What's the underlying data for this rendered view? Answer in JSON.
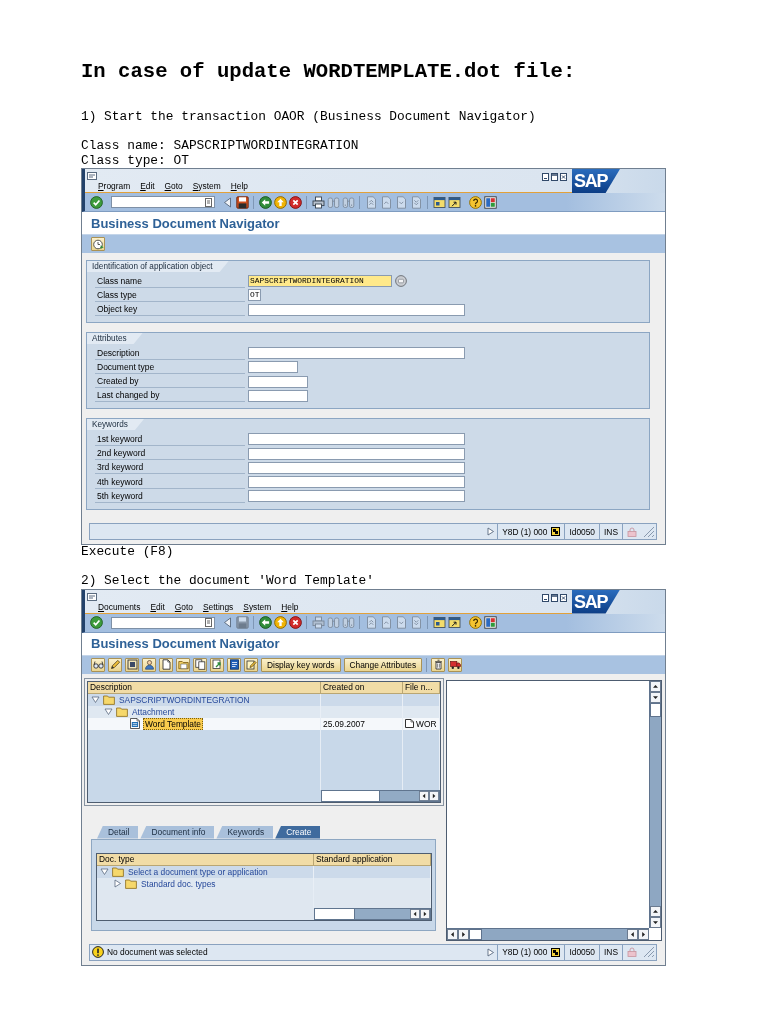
{
  "heading": "In case of update WORDTEMPLATE.dot file:",
  "content": [
    {
      "kind": "text",
      "lines": [
        "1) Start the transaction OAOR (Business Document Navigator)"
      ]
    },
    {
      "kind": "text",
      "lines": [
        "Class name: SAPSCRIPTWORDINTEGRATION",
        "Class type: OT"
      ]
    },
    {
      "kind": "screen",
      "logo": "SAP",
      "menu": [
        "Program",
        "Edit",
        "Goto",
        "System",
        "Help"
      ],
      "toolbar": [
        {
          "kind": "enter",
          "disabled": false
        },
        {
          "kind": "command"
        },
        {
          "kind": "collapse",
          "disabled": false
        },
        {
          "kind": "save",
          "disabled": false
        },
        {
          "kind": "separator"
        },
        {
          "kind": "back",
          "disabled": false
        },
        {
          "kind": "exit",
          "disabled": false
        },
        {
          "kind": "cancel",
          "disabled": false
        },
        {
          "kind": "separator"
        },
        {
          "kind": "print",
          "disabled": false
        },
        {
          "kind": "find",
          "disabled": true
        },
        {
          "kind": "findnext",
          "disabled": true
        },
        {
          "kind": "separator"
        },
        {
          "kind": "first",
          "disabled": true
        },
        {
          "kind": "previous",
          "disabled": true
        },
        {
          "kind": "next",
          "disabled": true
        },
        {
          "kind": "last",
          "disabled": true
        },
        {
          "kind": "separator"
        },
        {
          "kind": "session",
          "disabled": false
        },
        {
          "kind": "shortcut",
          "disabled": false
        },
        {
          "kind": "space"
        },
        {
          "kind": "help",
          "disabled": false
        },
        {
          "kind": "layout",
          "disabled": false
        }
      ],
      "title": "Business Document Navigator",
      "app_toolbar": [
        {
          "kind": "execute"
        }
      ],
      "body": {
        "kind": "form",
        "groups": [
          {
            "title": "Identification of application object",
            "fields": [
              {
                "label": "Class name",
                "value": "SAPSCRIPTWORDINTEGRATION",
                "kind": "large",
                "focused": true
              },
              {
                "label": "Class type",
                "value": "OT",
                "kind": "tiny",
                "focused": false
              },
              {
                "label": "Object key",
                "kind": "full",
                "focused": false
              }
            ]
          },
          {
            "title": "Attributes",
            "fields": [
              {
                "label": "Description",
                "kind": "full",
                "focused": false
              },
              {
                "label": "Document type",
                "kind": "small",
                "focused": false
              },
              {
                "label": "Created by",
                "kind": "medium",
                "focused": false
              },
              {
                "label": "Last changed by",
                "kind": "medium",
                "focused": false
              }
            ]
          },
          {
            "title": "Keywords",
            "fields": [
              {
                "label": "1st keyword",
                "kind": "full",
                "focused": false
              },
              {
                "label": "2nd keyword",
                "kind": "full",
                "focused": false
              },
              {
                "label": "3rd keyword",
                "kind": "full",
                "focused": false
              },
              {
                "label": "4th keyword",
                "kind": "full",
                "focused": false
              },
              {
                "label": "5th keyword",
                "kind": "full",
                "focused": false
              }
            ]
          }
        ]
      },
      "status": {
        "system": "Y8D (1) 000",
        "server": "Id0050",
        "mode": "INS"
      }
    },
    {
      "kind": "text",
      "lines": [
        "Execute (F8)"
      ]
    },
    {
      "kind": "text",
      "lines": [
        "2) Select the document 'Word Template'"
      ]
    },
    {
      "kind": "screen",
      "logo": "SAP",
      "menu": [
        "Documents",
        "Edit",
        "Goto",
        "Settings",
        "System",
        "Help"
      ],
      "toolbar": [
        {
          "kind": "enter",
          "disabled": false
        },
        {
          "kind": "command"
        },
        {
          "kind": "collapse",
          "disabled": false
        },
        {
          "kind": "save",
          "disabled": true
        },
        {
          "kind": "separator"
        },
        {
          "kind": "back",
          "disabled": false
        },
        {
          "kind": "exit",
          "disabled": false
        },
        {
          "kind": "cancel",
          "disabled": false
        },
        {
          "kind": "separator"
        },
        {
          "kind": "print",
          "disabled": true
        },
        {
          "kind": "find",
          "disabled": true
        },
        {
          "kind": "findnext",
          "disabled": true
        },
        {
          "kind": "separator"
        },
        {
          "kind": "first",
          "disabled": true
        },
        {
          "kind": "previous",
          "disabled": true
        },
        {
          "kind": "next",
          "disabled": true
        },
        {
          "kind": "last",
          "disabled": true
        },
        {
          "kind": "separator"
        },
        {
          "kind": "session",
          "disabled": false
        },
        {
          "kind": "shortcut",
          "disabled": false
        },
        {
          "kind": "space"
        },
        {
          "kind": "help",
          "disabled": false
        },
        {
          "kind": "layout",
          "disabled": false
        }
      ],
      "title": "Business Document Navigator",
      "app_toolbar": [
        {
          "kind": "glasses"
        },
        {
          "kind": "pencil"
        },
        {
          "kind": "frame"
        },
        {
          "kind": "person"
        },
        {
          "kind": "page"
        },
        {
          "kind": "folder"
        },
        {
          "kind": "copy"
        },
        {
          "kind": "import"
        },
        {
          "kind": "document"
        },
        {
          "kind": "note"
        },
        {
          "kind": "text",
          "label": "Display key words"
        },
        {
          "kind": "text",
          "label": "Change Attributes"
        },
        {
          "kind": "separator"
        },
        {
          "kind": "trash"
        },
        {
          "kind": "truck"
        }
      ],
      "body": {
        "kind": "navigator",
        "tree": {
          "columns": [
            "Description",
            "Created on",
            "File n..."
          ],
          "nodes": [
            {
              "text": "SAPSCRIPTWORDINTEGRATION",
              "kind": "folder",
              "expanded": true,
              "selected": false,
              "children": [
                {
                  "text": "Attachment",
                  "kind": "folder",
                  "expanded": true,
                  "selected": false,
                  "children": [
                    {
                      "text": "Word Template",
                      "kind": "document",
                      "selected": true,
                      "cells": [
                        {
                          "kind": "text",
                          "text": "25.09.2007"
                        },
                        {
                          "kind": "file",
                          "text": "WOR"
                        }
                      ]
                    }
                  ]
                }
              ]
            }
          ]
        },
        "tabs": [
          {
            "label": "Detail",
            "selected": false
          },
          {
            "label": "Document info",
            "selected": false
          },
          {
            "label": "Keywords",
            "selected": false
          },
          {
            "label": "Create",
            "selected": true
          }
        ],
        "tab_table": {
          "columns": [
            "Doc. type",
            "Standard application"
          ],
          "nodes": [
            {
              "text": "Select a document type or application",
              "kind": "folder",
              "expanded": true,
              "selected": false,
              "children": [
                {
                  "text": "Standard doc. types",
                  "kind": "folder",
                  "expanded": false,
                  "selected": false
                }
              ]
            }
          ]
        }
      },
      "status": {
        "message": {
          "kind": "warning",
          "text": "No document was selected"
        },
        "system": "Y8D (1) 000",
        "server": "Id0050",
        "mode": "INS"
      }
    }
  ]
}
